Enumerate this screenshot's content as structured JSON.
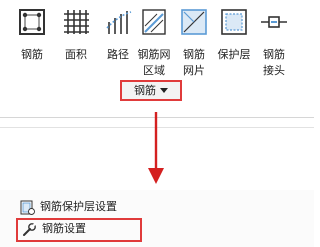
{
  "ribbon": {
    "tools": [
      {
        "icon": "rebar-icon",
        "label_line1": "钢筋",
        "label_line2": ""
      },
      {
        "icon": "area-grid-icon",
        "label_line1": "面积",
        "label_line2": ""
      },
      {
        "icon": "path-icon",
        "label_line1": "路径",
        "label_line2": ""
      },
      {
        "icon": "rebar-network-area-icon",
        "label_line1": "钢筋网",
        "label_line2": "区域"
      },
      {
        "icon": "rebar-mesh-sheet-icon",
        "label_line1": "钢筋",
        "label_line2": "网片"
      },
      {
        "icon": "cover-layer-icon",
        "label_line1": "保护层",
        "label_line2": ""
      },
      {
        "icon": "rebar-coupler-icon",
        "label_line1": "钢筋",
        "label_line2": "接头"
      }
    ],
    "panel_label": "钢筋"
  },
  "dropdown": {
    "items": [
      {
        "icon": "cover-settings-icon",
        "label": "钢筋保护层设置"
      },
      {
        "icon": "wrench-icon",
        "label": "钢筋设置"
      }
    ]
  },
  "colors": {
    "highlight": "#e03b3b",
    "arrow": "#d42020",
    "icon_blue": "#5b9bd5"
  }
}
